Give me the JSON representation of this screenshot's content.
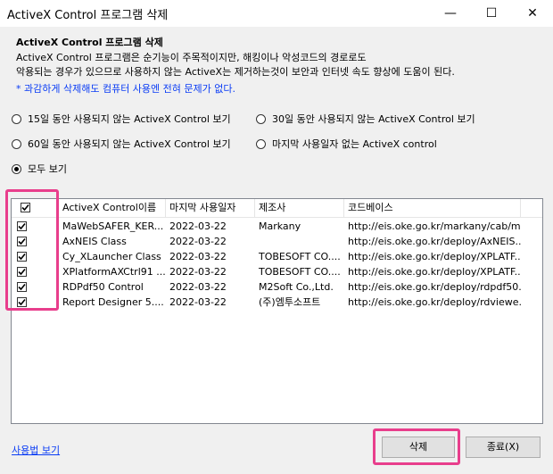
{
  "window": {
    "title": "ActiveX Control 프로그램 삭제",
    "min_icon": "—",
    "max_icon": "☐",
    "close_icon": "✕"
  },
  "intro": {
    "header": "ActiveX Control 프로그램 삭제",
    "line1": "ActiveX Control 프로그램은 순기능이 주목적이지만, 해킹이나 악성코드의 경로로도",
    "line2": "악용되는 경우가 있으므로 사용하지 않는 ActiveX는 제거하는것이 보안과 인터넷 속도 향상에 도움이 된다.",
    "note": "* 과감하게 삭제해도 컴퓨터 사용엔 전혀 문제가 없다."
  },
  "filters": [
    {
      "label": "15일 동안 사용되지 않는 ActiveX Control 보기",
      "selected": false
    },
    {
      "label": "30일 동안 사용되지 않는 ActiveX Control 보기",
      "selected": false
    },
    {
      "label": "60일 동안 사용되지 않는 ActiveX Control 보기",
      "selected": false
    },
    {
      "label": "마지막 사용일자 없는 ActiveX control",
      "selected": false
    },
    {
      "label": "모두 보기",
      "selected": true
    }
  ],
  "table": {
    "columns": [
      "ActiveX Control이름",
      "마지막 사용일자",
      "제조사",
      "코드베이스"
    ],
    "header_checked": true,
    "rows": [
      {
        "checked": true,
        "name": "MaWebSAFER_KER...",
        "date": "2022-03-22",
        "vendor": "Markany",
        "codebase": "http://eis.oke.go.kr/markany/cab/m..."
      },
      {
        "checked": true,
        "name": "AxNEIS Class",
        "date": "2022-03-22",
        "vendor": "",
        "codebase": "http://eis.oke.go.kr/deploy/AxNEIS...."
      },
      {
        "checked": true,
        "name": "Cy_XLauncher Class",
        "date": "2022-03-22",
        "vendor": "TOBESOFT CO....",
        "codebase": "http://eis.oke.go.kr/deploy/XPLATF..."
      },
      {
        "checked": true,
        "name": "XPlatformAXCtrl91 ...",
        "date": "2022-03-22",
        "vendor": "TOBESOFT CO....",
        "codebase": "http://eis.oke.go.kr/deploy/XPLATF..."
      },
      {
        "checked": true,
        "name": "RDPdf50 Control",
        "date": "2022-03-22",
        "vendor": "M2Soft Co.,Ltd.",
        "codebase": "http://eis.oke.go.kr/deploy/rdpdf50..."
      },
      {
        "checked": true,
        "name": "Report Designer 5....",
        "date": "2022-03-22",
        "vendor": "(주)엠투소프트",
        "codebase": "http://eis.oke.go.kr/deploy/rdviewe..."
      }
    ]
  },
  "footer": {
    "help_link": "사용법 보기",
    "delete_label": "삭제",
    "close_label": "종료(X)"
  },
  "colors": {
    "highlight": "#e83e8c",
    "link": "#0a3cf5",
    "background": "#f0f0f0"
  }
}
